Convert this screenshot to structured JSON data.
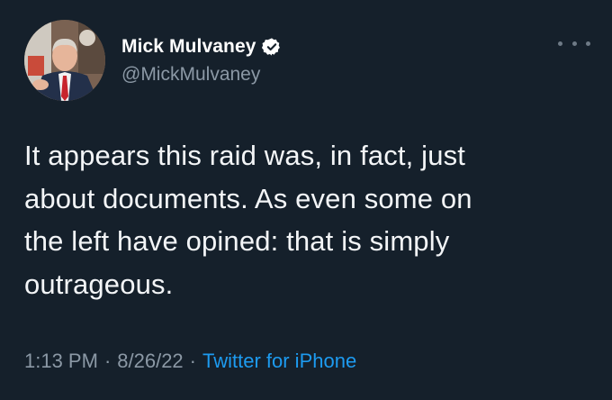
{
  "tweet": {
    "display_name": "Mick Mulvaney",
    "handle": "@MickMulvaney",
    "text": "It appears this raid was, in fact, just\nabout documents.  As even some on\nthe left have opined: that is simply\noutrageous.",
    "time": "1:13 PM",
    "date": "8/26/22",
    "separator": "·",
    "source": "Twitter for iPhone"
  },
  "icons": {
    "verified": "verified-badge-icon",
    "more": "more-options-icon"
  },
  "colors": {
    "background": "#15202b",
    "secondary_text": "#8b98a5",
    "accent": "#1d9bf0"
  }
}
